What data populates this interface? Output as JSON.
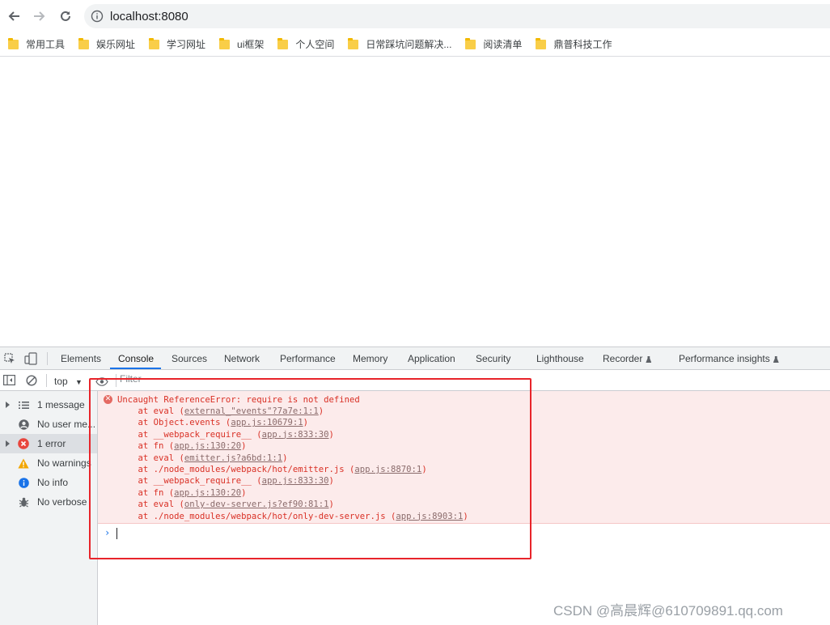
{
  "browser": {
    "url": "localhost:8080",
    "bookmarks": [
      "常用工具",
      "娱乐网址",
      "学习网址",
      "ui框架",
      "个人空间",
      "日常踩坑问题解决...",
      "阅读清单",
      "鼎普科技工作"
    ]
  },
  "devtools": {
    "tabs": [
      "Elements",
      "Console",
      "Sources",
      "Network",
      "Performance",
      "Memory",
      "Application",
      "Security",
      "Lighthouse",
      "Recorder",
      "Performance insights"
    ],
    "active_tab": "Console",
    "context": "top",
    "filter_placeholder": "Filter",
    "sidebar": [
      {
        "label": "1 message",
        "icon": "list-icon",
        "expandable": true
      },
      {
        "label": "No user me...",
        "icon": "user-icon",
        "expandable": false
      },
      {
        "label": "1 error",
        "icon": "error-icon",
        "expandable": true,
        "selected": true
      },
      {
        "label": "No warnings",
        "icon": "warning-icon",
        "expandable": false
      },
      {
        "label": "No info",
        "icon": "info-icon",
        "expandable": false
      },
      {
        "label": "No verbose",
        "icon": "bug-icon",
        "expandable": false
      }
    ],
    "error": {
      "message": "Uncaught ReferenceError: require is not defined",
      "stack": [
        {
          "prefix": "    at eval (",
          "link": "external_\"events\"?7a7e:1:1",
          "suffix": ")"
        },
        {
          "prefix": "    at Object.events (",
          "link": "app.js:10679:1",
          "suffix": ")"
        },
        {
          "prefix": "    at __webpack_require__ (",
          "link": "app.js:833:30",
          "suffix": ")"
        },
        {
          "prefix": "    at fn (",
          "link": "app.js:130:20",
          "suffix": ")"
        },
        {
          "prefix": "    at eval (",
          "link": "emitter.js?a6bd:1:1",
          "suffix": ")"
        },
        {
          "prefix": "    at ./node_modules/webpack/hot/emitter.js (",
          "link": "app.js:8870:1",
          "suffix": ")"
        },
        {
          "prefix": "    at __webpack_require__ (",
          "link": "app.js:833:30",
          "suffix": ")"
        },
        {
          "prefix": "    at fn (",
          "link": "app.js:130:20",
          "suffix": ")"
        },
        {
          "prefix": "    at eval (",
          "link": "only-dev-server.js?ef90:81:1",
          "suffix": ")"
        },
        {
          "prefix": "    at ./node_modules/webpack/hot/only-dev-server.js (",
          "link": "app.js:8903:1",
          "suffix": ")"
        }
      ]
    }
  },
  "watermark": "CSDN @高晨辉@610709891.qq.com",
  "colors": {
    "error_red": "#d93025",
    "error_bg": "#fcebeb",
    "annotation_red": "#e8242a",
    "accent": "#1a73e8"
  }
}
